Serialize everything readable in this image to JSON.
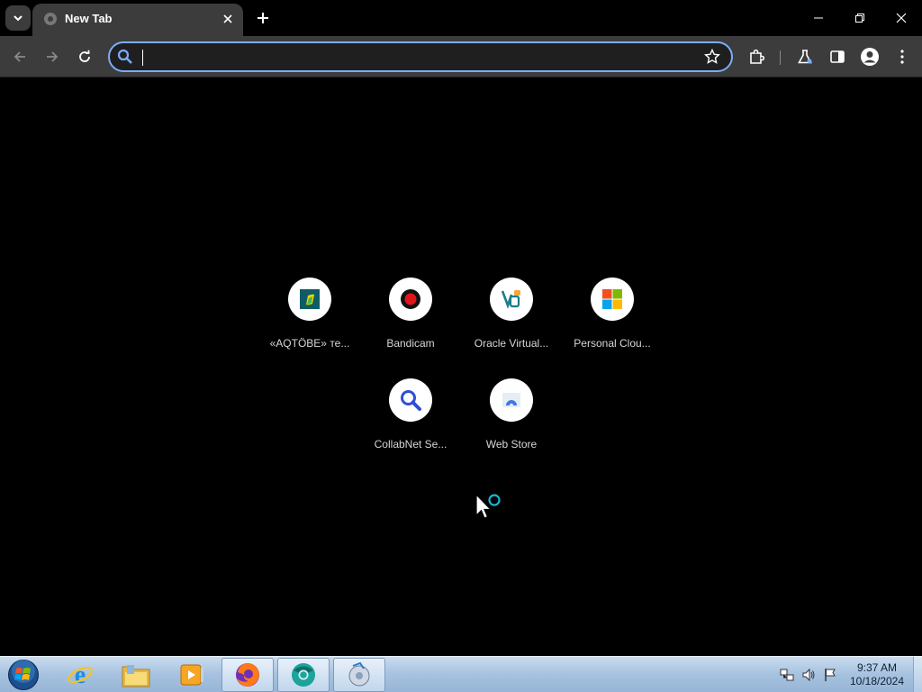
{
  "browser": {
    "tab": {
      "title": "New Tab"
    },
    "omnibox": {
      "value": "",
      "placeholder": ""
    }
  },
  "shortcuts": [
    {
      "label": "«AQTÖBE» те...",
      "icon": "aqtobe-icon"
    },
    {
      "label": "Bandicam",
      "icon": "bandicam-icon"
    },
    {
      "label": "Oracle Virtual...",
      "icon": "virtualbox-icon"
    },
    {
      "label": "Personal Clou...",
      "icon": "microsoft-icon"
    },
    {
      "label": "CollabNet Se...",
      "icon": "collabnet-search-icon"
    },
    {
      "label": "Web Store",
      "icon": "web-store-icon"
    }
  ],
  "taskbar": {
    "apps": [
      "internet-explorer-icon",
      "file-explorer-icon",
      "media-player-icon",
      "firefox-icon",
      "chrome-canary-icon",
      "media-center-icon"
    ],
    "clock": {
      "time": "9:37 AM",
      "date": "10/18/2024"
    }
  },
  "colors": {
    "accent": "#7cacf8",
    "toolbar": "#3c3c3c",
    "background": "#000000"
  }
}
